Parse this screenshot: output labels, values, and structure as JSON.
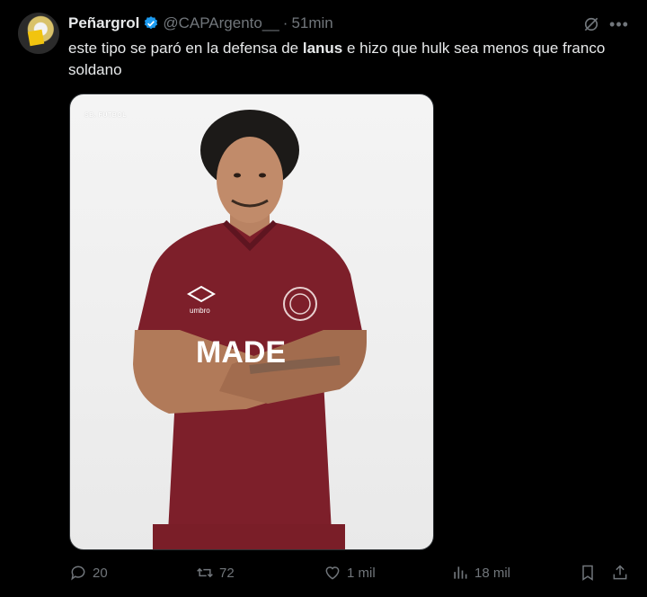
{
  "author": {
    "display_name": "Peñargrol",
    "handle": "@CAPArgento__",
    "separator": "·",
    "time": "51min"
  },
  "tweet": {
    "text_part1": "este tipo se paró en la defensa de ",
    "text_bold": "lanus",
    "text_part2": " e hizo que hulk sea menos que franco soldano"
  },
  "media": {
    "watermark": "SB. FUTBOL",
    "jersey_sponsor": "MADE",
    "jersey_brand": "umbro",
    "colors": {
      "jersey": "#7d1f2a",
      "background": "#f2f2f2"
    }
  },
  "actions": {
    "replies": "20",
    "reposts": "72",
    "likes": "1 mil",
    "views": "18 mil"
  },
  "icons": [
    "verified-icon",
    "grok-icon",
    "more-icon",
    "reply-icon",
    "repost-icon",
    "like-icon",
    "views-icon",
    "bookmark-icon",
    "share-icon"
  ],
  "colors": {
    "background": "#000000",
    "text": "#e7e9ea",
    "secondary": "#71767b",
    "verified": "#1d9bf0"
  }
}
